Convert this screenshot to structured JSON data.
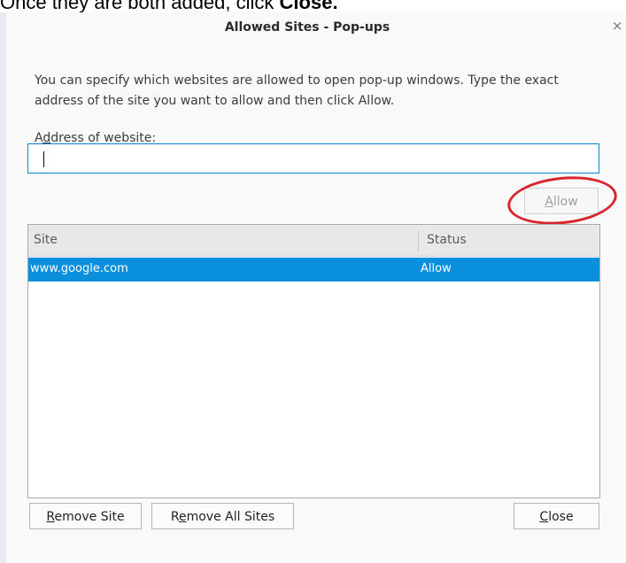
{
  "caption": {
    "prefix": "Once they are both added, click ",
    "bold": "Close."
  },
  "dialog": {
    "title": "Allowed Sites - Pop-ups",
    "close_glyph": "×",
    "description": "You can specify which websites are allowed to open pop-up windows. Type the exact address of the site you want to allow and then click Allow.",
    "address_label": "Address of website:",
    "address_value": "",
    "allow_button": "Allow",
    "list": {
      "columns": [
        "Site",
        "Status"
      ],
      "rows": [
        {
          "site": "www.google.com",
          "status": "Allow",
          "selected": true
        }
      ]
    },
    "buttons": {
      "remove_site": "Remove Site",
      "remove_all": "Remove All Sites",
      "close": "Close"
    }
  },
  "colors": {
    "selection": "#0a8fdc",
    "input_focus_border": "#0a84d6",
    "annotation_ring": "#d8262e"
  },
  "icons": {
    "close": "close-icon"
  }
}
